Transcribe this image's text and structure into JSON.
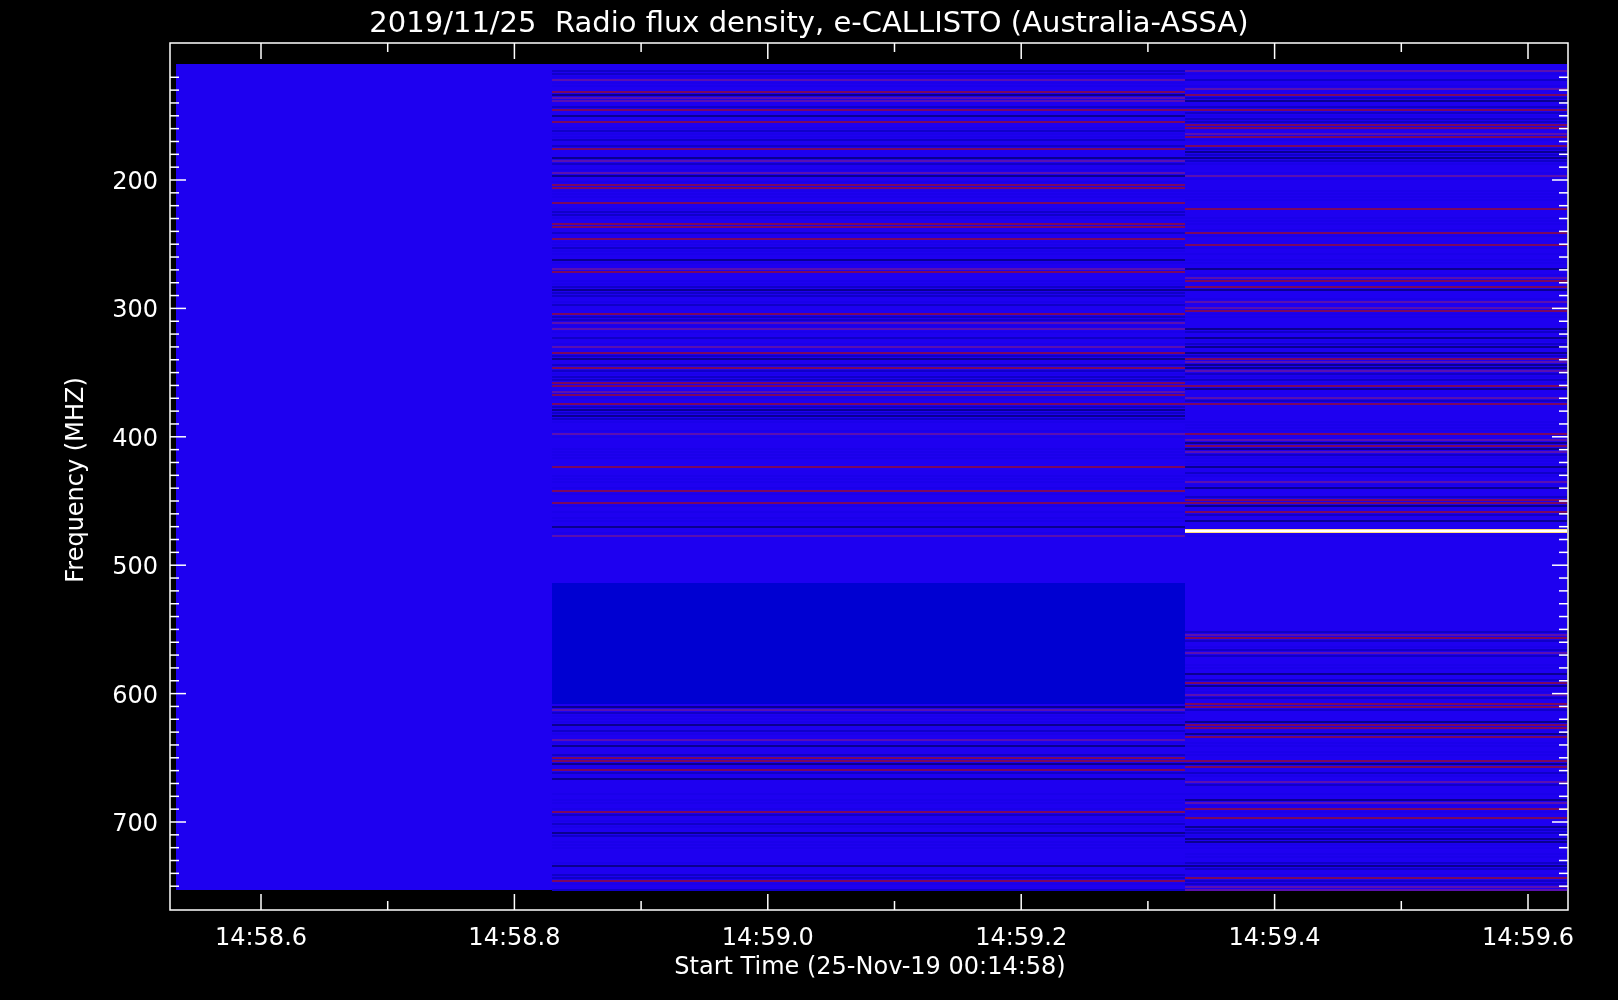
{
  "plot": {
    "title": "2019/11/25  Radio flux density, e-CALLISTO (Australia-ASSA)",
    "y_axis": {
      "label": "Frequency (MHZ)",
      "ticks": [
        "200",
        "300",
        "400",
        "500",
        "600",
        "700"
      ]
    },
    "x_axis": {
      "label": "Start Time (25-Nov-19 00:14:58)",
      "ticks": [
        "14:58.6",
        "14:58.8",
        "14:59.0",
        "14:59.2",
        "14:59.4",
        "14:59.6"
      ]
    }
  }
}
